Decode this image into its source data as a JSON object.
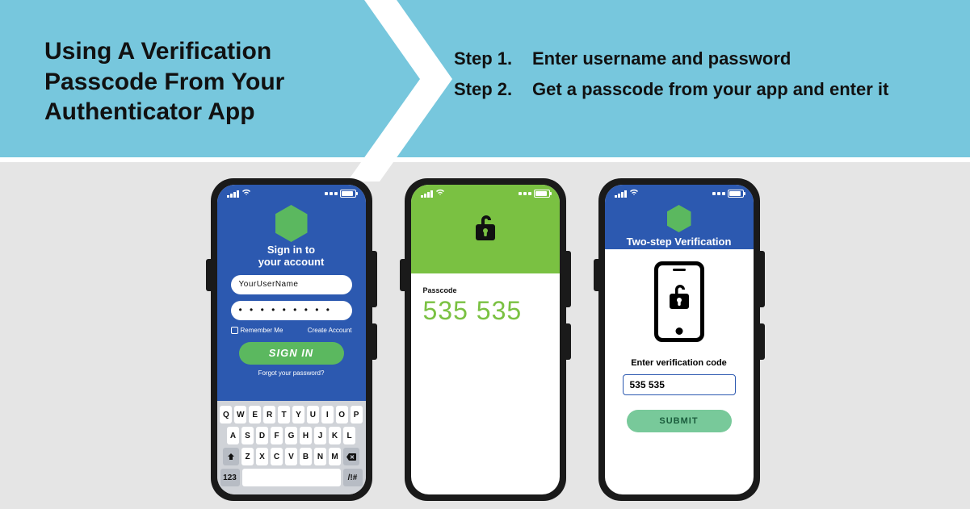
{
  "banner": {
    "title": "Using A Verification Passcode From Your Authenticator App",
    "steps": [
      {
        "num": "Step 1.",
        "text": "Enter username and password"
      },
      {
        "num": "Step 2.",
        "text": "Get a passcode from your app and enter it"
      }
    ]
  },
  "phone1": {
    "title_line1": "Sign in to",
    "title_line2": "your account",
    "username": "YourUserName",
    "password_mask": "• • • • • • • • •",
    "remember": "Remember Me",
    "create": "Create Account",
    "signin": "SIGN IN",
    "forgot": "Forgot your password?",
    "kb_row1": [
      "Q",
      "W",
      "E",
      "R",
      "T",
      "Y",
      "U",
      "I",
      "O",
      "P"
    ],
    "kb_row2": [
      "A",
      "S",
      "D",
      "F",
      "G",
      "H",
      "J",
      "K",
      "L"
    ],
    "kb_row3": [
      "Z",
      "X",
      "C",
      "V",
      "B",
      "N",
      "M"
    ],
    "kb_123": "123",
    "kb_sym": "/!#"
  },
  "phone2": {
    "label": "Passcode",
    "code": "535 535"
  },
  "phone3": {
    "title": "Two-step Verification",
    "label": "Enter verification code",
    "input": "535 535",
    "submit": "SUBMIT"
  }
}
